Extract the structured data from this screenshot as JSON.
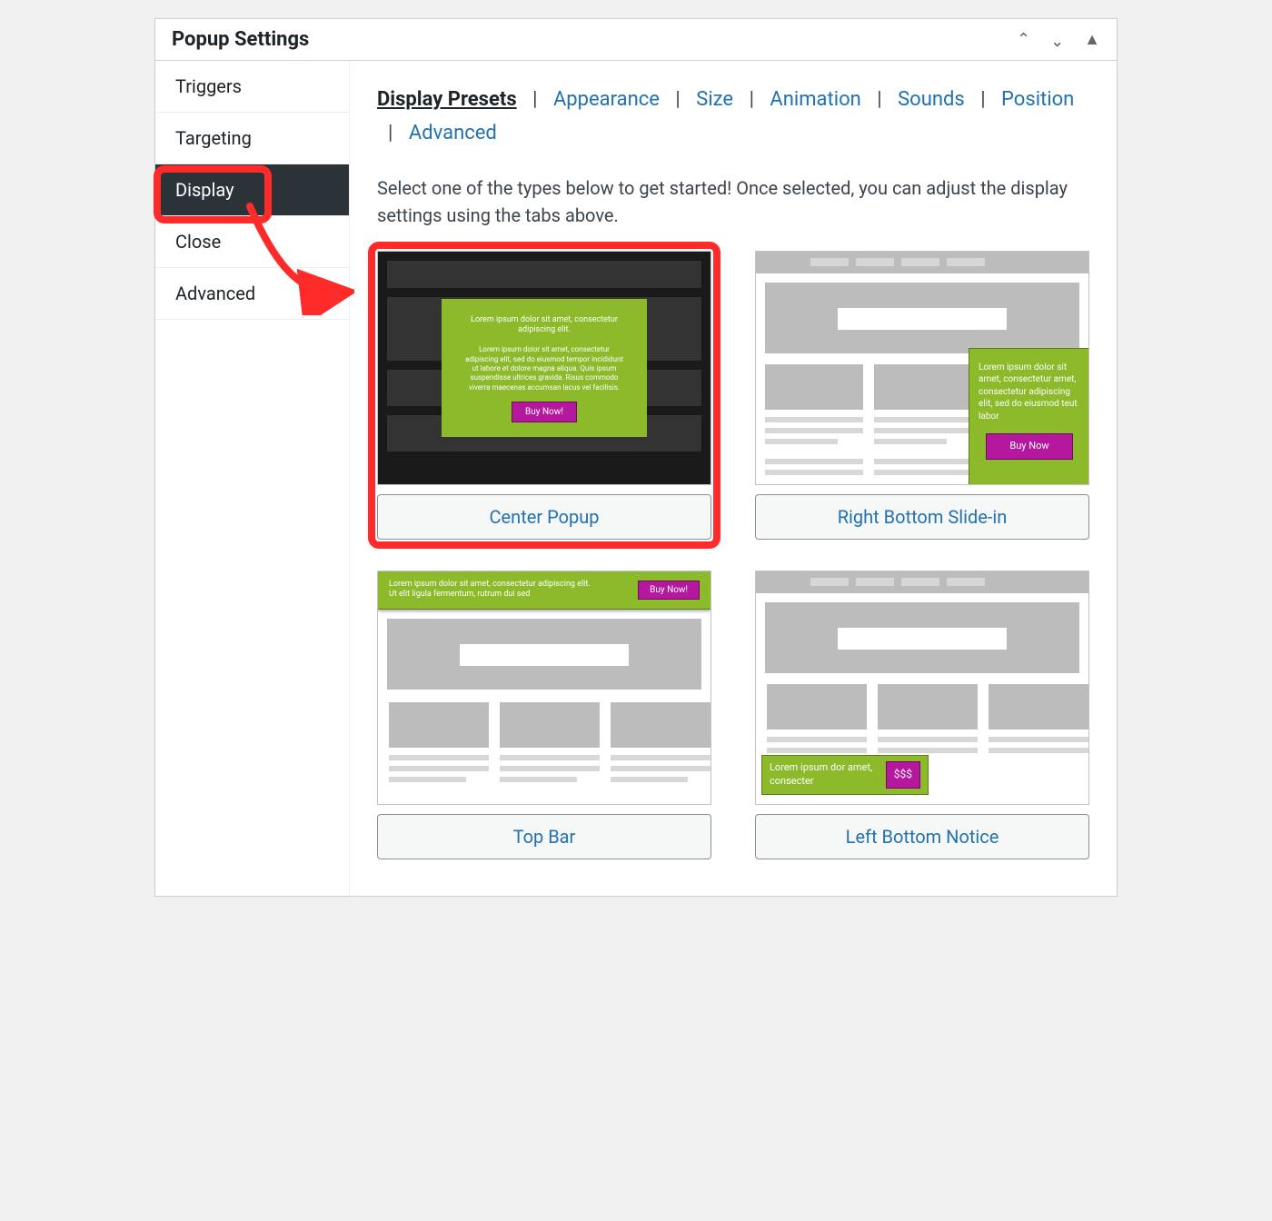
{
  "panel": {
    "title": "Popup Settings"
  },
  "sidebar": {
    "items": [
      {
        "label": "Triggers"
      },
      {
        "label": "Targeting"
      },
      {
        "label": "Display"
      },
      {
        "label": "Close"
      },
      {
        "label": "Advanced"
      }
    ]
  },
  "tabs": {
    "items": [
      "Display Presets",
      "Appearance",
      "Size",
      "Animation",
      "Sounds",
      "Position",
      "Advanced"
    ]
  },
  "intro": "Select one of the types below to get started! Once selected, you can adjust the display settings using the tabs above.",
  "presets": {
    "center": {
      "label": "Center Popup",
      "heading": "Lorem ipsum dolor sit amet, consectetur adipiscing elit.",
      "body": "Lorem ipsum dolor sit amet, consectetur adipiscing elit, sed do eiusmod tempor incididunt ut labore et dolore magna aliqua. Quis ipsum suspendisse ultrices gravida. Risus commodo viverra maecenas accumsan lacus vel facilisis.",
      "cta": "Buy Now!"
    },
    "right_bottom": {
      "label": "Right Bottom Slide-in",
      "body": "Lorem ipsum dolor sit amet, consectetur amet, consectetur adipiscing elit, sed do eiusmod teut labor",
      "cta": "Buy Now"
    },
    "top_bar": {
      "label": "Top Bar",
      "line1": "Lorem ipsum dolor sit amet, consectetur adipiscing elit.",
      "line2": "Ut elit ligula fermentum, rutrum dui sed",
      "cta": "Buy Now!"
    },
    "left_bottom": {
      "label": "Left Bottom Notice",
      "body": "Lorem ipsum dor amet, consecter",
      "badge": "$$$"
    }
  }
}
